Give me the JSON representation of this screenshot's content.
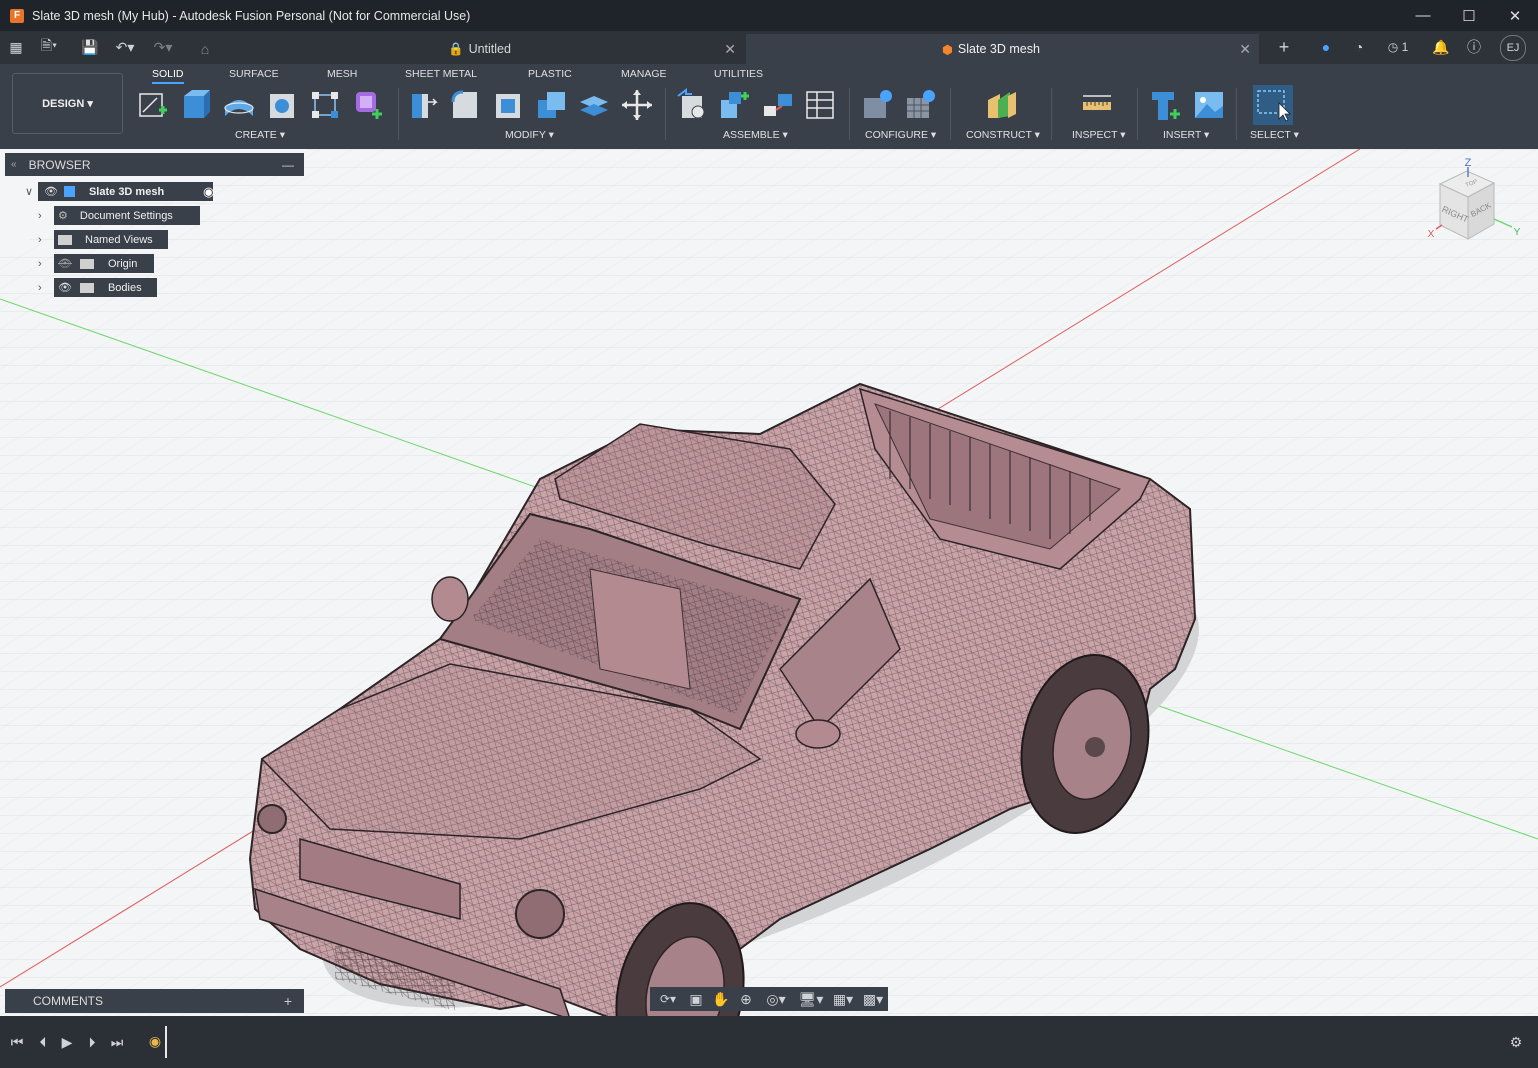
{
  "window": {
    "title": "Slate 3D mesh (My Hub) - Autodesk Fusion Personal (Not for Commercial Use)",
    "app_badge": "F"
  },
  "tabs": [
    {
      "label": "Untitled",
      "active": false
    },
    {
      "label": "Slate 3D mesh",
      "active": true
    }
  ],
  "header_right": {
    "jobs_count": "1",
    "user_initials": "EJ"
  },
  "toolbar": {
    "workspace": "DESIGN",
    "tabs": [
      "SOLID",
      "SURFACE",
      "MESH",
      "SHEET METAL",
      "PLASTIC",
      "MANAGE",
      "UTILITIES"
    ],
    "groups": [
      "CREATE",
      "MODIFY",
      "ASSEMBLE",
      "CONFIGURE",
      "CONSTRUCT",
      "INSPECT",
      "INSERT",
      "SELECT"
    ]
  },
  "browser": {
    "title": "BROWSER",
    "root": "Slate 3D mesh",
    "items": [
      "Document Settings",
      "Named Views",
      "Origin",
      "Bodies"
    ]
  },
  "comments": {
    "title": "COMMENTS"
  },
  "viewcube": {
    "top": "TOP",
    "right": "RIGHT",
    "back": "BACK",
    "x": "X",
    "y": "Y",
    "z": "Z"
  },
  "colors": {
    "accent": "#4aa3ff",
    "mesh_fill": "#c9a3a8",
    "mesh_wire": "#3c2f33",
    "x_axis": "#e05a5a",
    "y_axis": "#6ad86a"
  }
}
